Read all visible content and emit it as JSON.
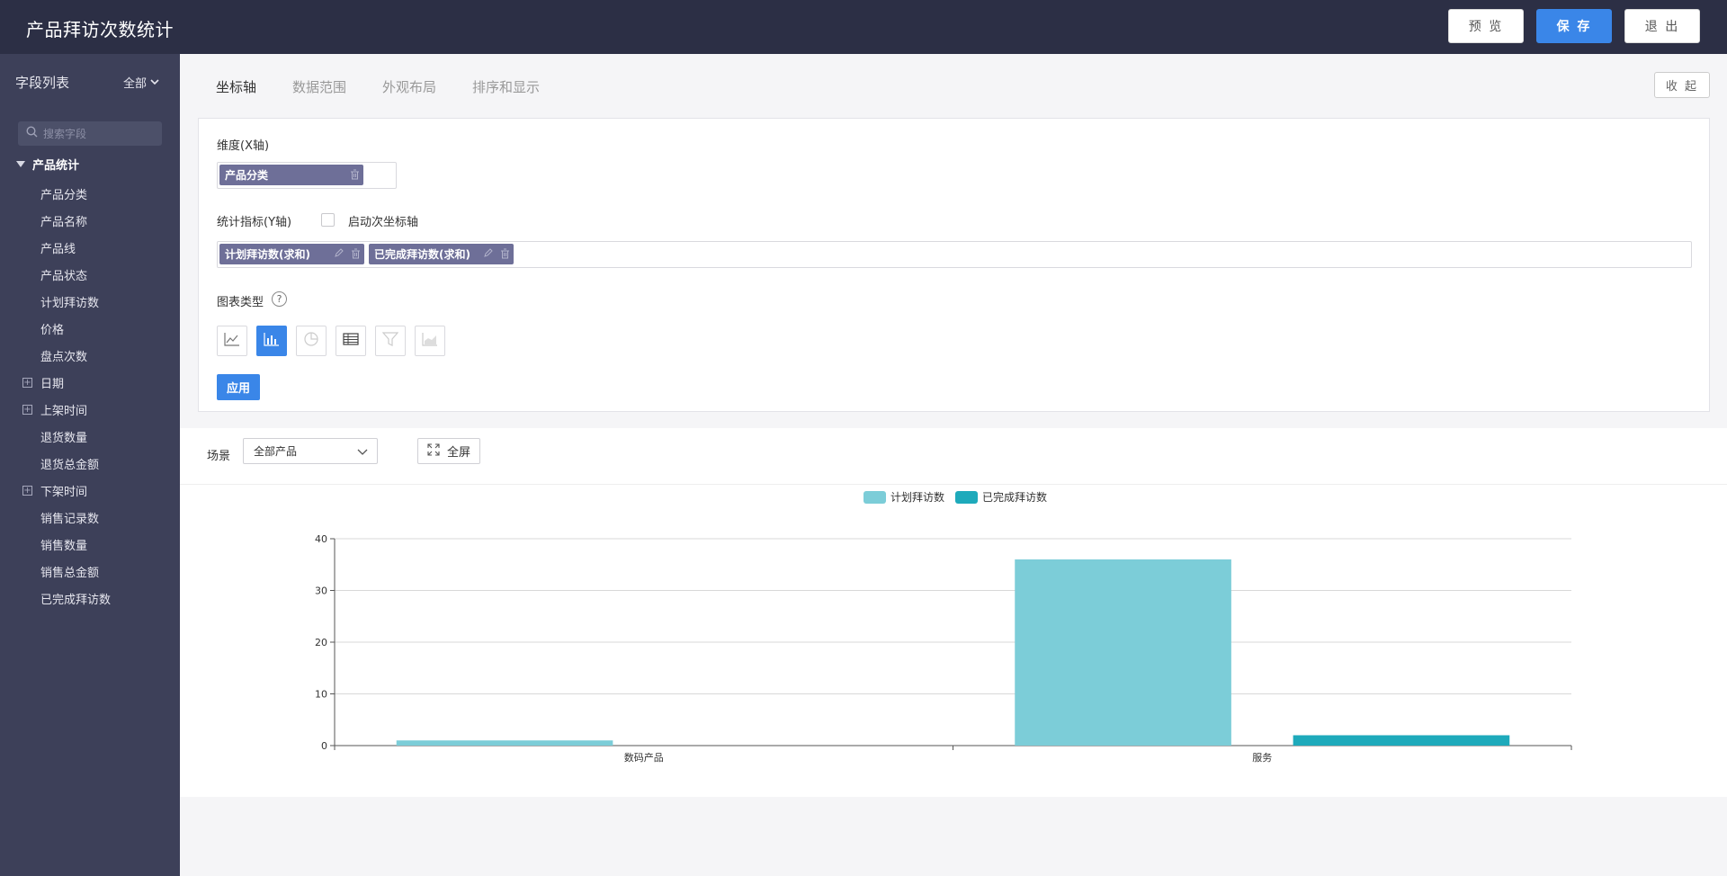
{
  "header": {
    "title": "产品拜访次数统计",
    "preview_label": "预 览",
    "save_label": "保 存",
    "exit_label": "退 出"
  },
  "sidebar": {
    "title": "字段列表",
    "filter_label": "全部",
    "search_placeholder": "搜索字段",
    "group_label": "产品统计",
    "items": [
      {
        "label": "产品分类",
        "expandable": false
      },
      {
        "label": "产品名称",
        "expandable": false
      },
      {
        "label": "产品线",
        "expandable": false
      },
      {
        "label": "产品状态",
        "expandable": false
      },
      {
        "label": "计划拜访数",
        "expandable": false
      },
      {
        "label": "价格",
        "expandable": false
      },
      {
        "label": "盘点次数",
        "expandable": false
      },
      {
        "label": "日期",
        "expandable": true
      },
      {
        "label": "上架时间",
        "expandable": true
      },
      {
        "label": "退货数量",
        "expandable": false
      },
      {
        "label": "退货总金额",
        "expandable": false
      },
      {
        "label": "下架时间",
        "expandable": true
      },
      {
        "label": "销售记录数",
        "expandable": false
      },
      {
        "label": "销售数量",
        "expandable": false
      },
      {
        "label": "销售总金额",
        "expandable": false
      },
      {
        "label": "已完成拜访数",
        "expandable": false
      }
    ]
  },
  "tabs": [
    {
      "label": "坐标轴",
      "active": true
    },
    {
      "label": "数据范围",
      "active": false
    },
    {
      "label": "外观布局",
      "active": false
    },
    {
      "label": "排序和显示",
      "active": false
    }
  ],
  "collapse_label": "收 起",
  "config": {
    "x_axis_label": "维度(X轴)",
    "x_fields": [
      "产品分类"
    ],
    "y_axis_label": "统计指标(Y轴)",
    "secondary_axis_label": "启动次坐标轴",
    "secondary_axis_checked": false,
    "y_fields": [
      "计划拜访数(求和)",
      "已完成拜访数(求和)"
    ],
    "chart_type_label": "图表类型",
    "chart_types": [
      "line",
      "bar",
      "pie",
      "table",
      "funnel",
      "area"
    ],
    "active_chart_type": "bar",
    "apply_label": "应用"
  },
  "scene": {
    "label": "场景",
    "selected": "全部产品",
    "fullscreen_label": "全屏"
  },
  "colors": {
    "header_bg": "#2c2f45",
    "sidebar_bg": "#3d4059",
    "accent": "#3a86e8",
    "pill": "#6e6f98",
    "series_planned": "#7ccdd8",
    "series_completed": "#1eaabb"
  },
  "chart_data": {
    "type": "bar",
    "categories": [
      "数码产品",
      "服务"
    ],
    "series": [
      {
        "name": "计划拜访数",
        "values": [
          1,
          36
        ]
      },
      {
        "name": "已完成拜访数",
        "values": [
          0,
          2
        ]
      }
    ],
    "ylim": [
      0,
      40
    ],
    "yticks": [
      0,
      10,
      20,
      30,
      40
    ],
    "grid": true,
    "legend": "top-center"
  }
}
